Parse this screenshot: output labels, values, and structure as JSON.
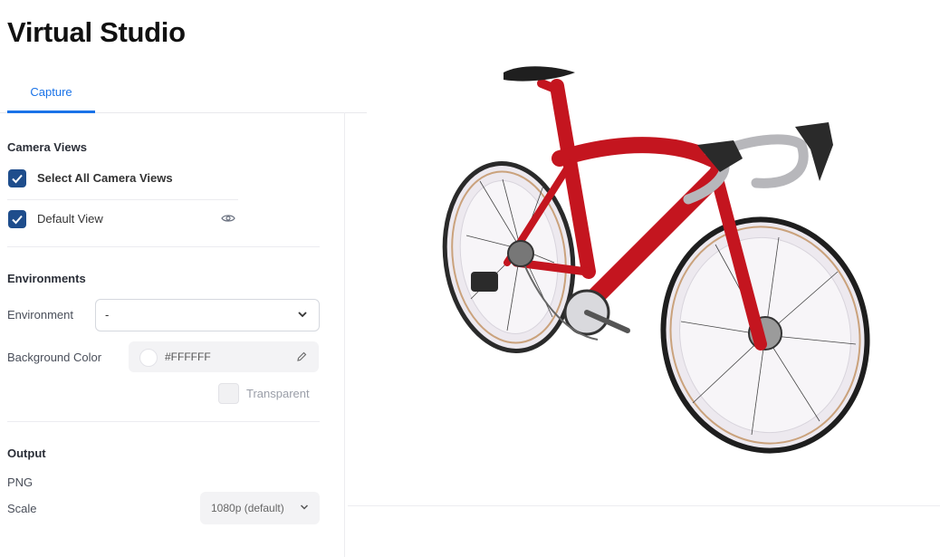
{
  "app": {
    "title": "Virtual Studio"
  },
  "tabs": [
    {
      "label": "Capture",
      "active": true
    }
  ],
  "camera_views": {
    "title": "Camera Views",
    "select_all": {
      "label": "Select All Camera Views",
      "checked": true
    },
    "views": [
      {
        "label": "Default View",
        "checked": true,
        "icon": "eye-icon"
      }
    ]
  },
  "environments": {
    "title": "Environments",
    "environment": {
      "label": "Environment",
      "value": "-"
    },
    "background": {
      "label": "Background Color",
      "value": "#FFFFFF",
      "swatch": "#FFFFFF"
    },
    "transparent": {
      "label": "Transparent",
      "checked": false
    }
  },
  "output": {
    "title": "Output",
    "format": "PNG",
    "scale": {
      "label": "Scale",
      "value": "1080p (default)"
    }
  },
  "colors": {
    "accent": "#1a73e8",
    "checkbox": "#1e4d8c",
    "bike_frame": "#c4151f"
  }
}
